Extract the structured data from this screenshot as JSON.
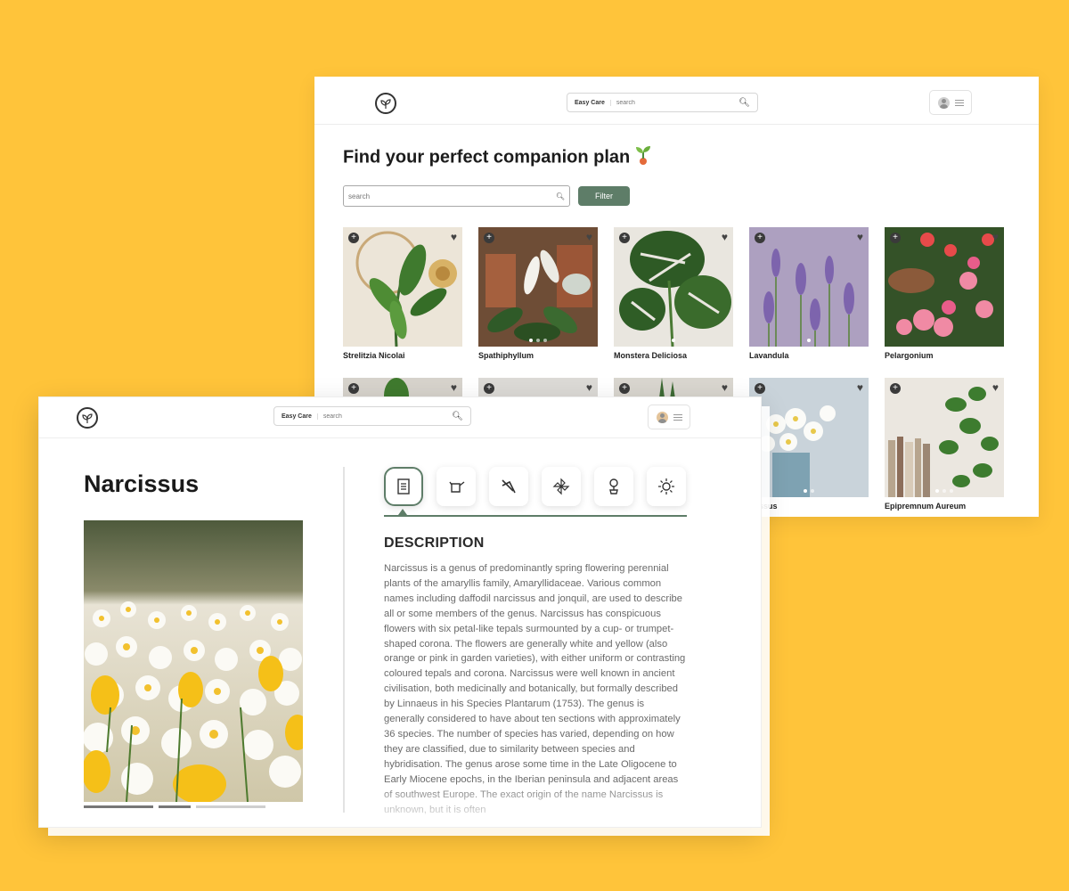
{
  "colors": {
    "background": "#FFC43A",
    "accent": "#5E7D68"
  },
  "catalog": {
    "header": {
      "logo_icon": "leaf-logo-icon",
      "search_category": "Easy Care",
      "search_placeholder": "search"
    },
    "title": "Find your perfect companion plan",
    "search_placeholder": "search",
    "filter_label": "Filter",
    "plants": [
      {
        "name": "Strelitzia Nicolai"
      },
      {
        "name": "Spathiphyllum"
      },
      {
        "name": "Monstera Deliciosa"
      },
      {
        "name": "Lavandula"
      },
      {
        "name": "Pelargonium"
      },
      {
        "name": ""
      },
      {
        "name": ""
      },
      {
        "name": ""
      },
      {
        "name": "rcissus"
      },
      {
        "name": "Epipremnum Aureum"
      }
    ]
  },
  "detail": {
    "header": {
      "search_category": "Easy Care",
      "search_placeholder": "search"
    },
    "title": "Narcissus",
    "tabs": [
      "description-icon",
      "watering-can-icon",
      "pruning-shears-icon",
      "wind-icon",
      "plant-pot-icon",
      "sun-icon"
    ],
    "section_title": "DESCRIPTION",
    "description": "Narcissus is a genus of predominantly spring flowering perennial plants of the amaryllis family, Amaryllidaceae. Various common names including daffodil narcissus and jonquil, are used to describe all or some members of the genus. Narcissus has conspicuous flowers with six petal-like tepals surmounted by a cup- or trumpet-shaped corona. The flowers are generally white and yellow (also orange or pink in garden varieties), with either uniform or contrasting coloured tepals and corona. Narcissus were well known in ancient civilisation, both medicinally and botanically, but formally described by Linnaeus in his Species Plantarum (1753). The genus is generally considered to have about ten sections with approximately 36 species. The number of species has varied, depending on how they are classified, due to similarity between species and hybridisation. The genus arose some time in the Late Oligocene to Early Miocene epochs, in the Iberian peninsula and adjacent areas of southwest Europe. The exact origin of the name Narcissus is unknown, but it is often"
  }
}
